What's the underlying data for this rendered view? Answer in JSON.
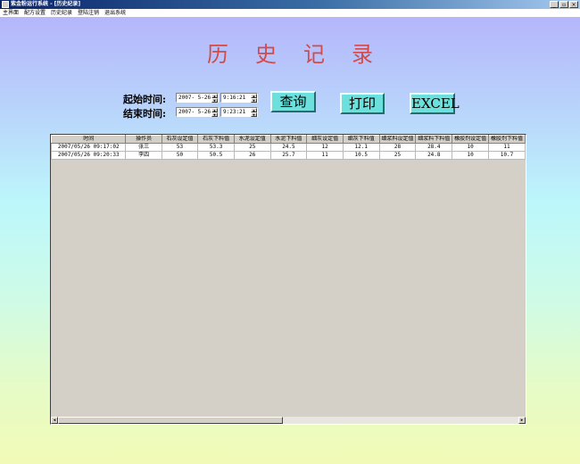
{
  "window": {
    "title": "紫金粉运行系统 - [历史纪录]",
    "buttons": [
      "_",
      "▫",
      "×"
    ]
  },
  "menu": [
    "主界面",
    "配方设置",
    "历史纪录",
    "登陆注销",
    "退出系统"
  ],
  "page_title": "历史记录",
  "query": {
    "start_label": "起始时间:",
    "end_label": "结束时间:",
    "start_date": "2007- 5-26",
    "start_time": "9:16:21",
    "end_date": "2007- 5-26",
    "end_time": "9:23:21"
  },
  "buttons": {
    "query": "查询",
    "print": "打印",
    "excel": "EXCEL"
  },
  "table": {
    "columns": [
      "时间",
      "操作员",
      "石灰设定值",
      "石灰下料值",
      "水泥设定值",
      "水泥下料值",
      "细灰设定值",
      "细灰下料值",
      "细浆料设定值",
      "细浆料下料值",
      "橡胶剂设定值",
      "橡胶剂下料值"
    ],
    "rows": [
      [
        "2007/05/26 09:17:02",
        "张三",
        "53",
        "53.3",
        "25",
        "24.5",
        "12",
        "12.1",
        "28",
        "28.4",
        "10",
        "11"
      ],
      [
        "2007/05/26 09:20:33",
        "李四",
        "50",
        "50.5",
        "26",
        "25.7",
        "11",
        "10.5",
        "25",
        "24.8",
        "10",
        "10.7"
      ]
    ]
  },
  "scrollbar": {
    "left_arrow": "◂",
    "right_arrow": "▸"
  }
}
